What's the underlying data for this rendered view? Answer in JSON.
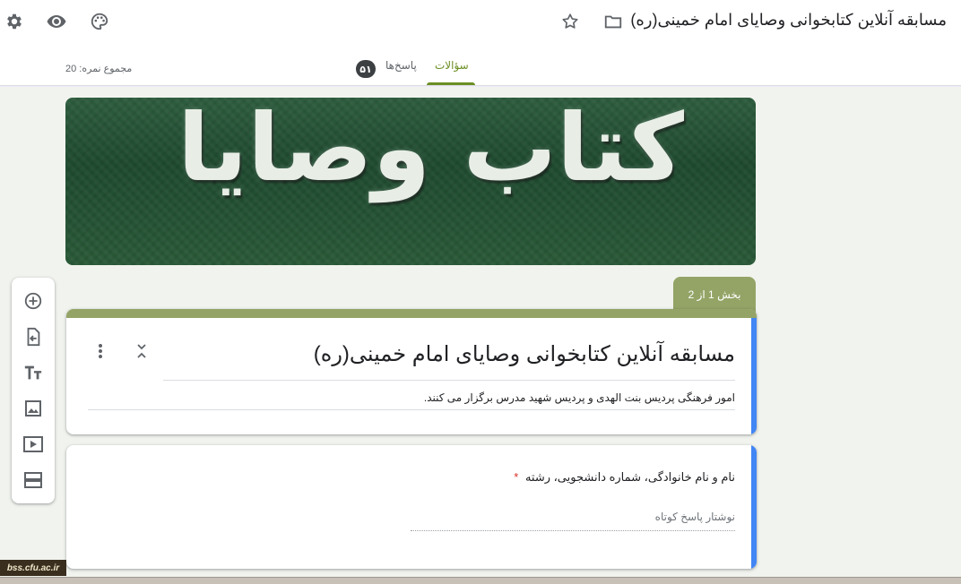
{
  "header": {
    "form_title": "مسابقه آنلاین کتابخوانی وصایای امام خمینی(ره)",
    "icons": [
      "settings-icon",
      "preview-eye-icon",
      "palette-icon",
      "star-icon",
      "folder-icon"
    ]
  },
  "tabs": {
    "questions_label": "سؤالات",
    "responses_label": "پاسخ‌ها",
    "responses_count": "۵۱",
    "total_points": "مجموع نمره: 20"
  },
  "header_image": {
    "big_text": "کتاب وصایا"
  },
  "section": {
    "indicator": "بخش 1 از 2"
  },
  "title_card": {
    "title": "مسابقه آنلاین کتابخوانی وصایای امام خمینی(ره)",
    "description": "امور فرهنگی پردیس بنت الهدی و پردیس شهید مدرس برگزار می کنند."
  },
  "question": {
    "text": "نام و نام خانوادگی، شماره دانشجویی، رشته",
    "required_mark": "*",
    "answer_placeholder": "نوشتار پاسخ کوتاه"
  },
  "toolbar": {
    "icons": [
      "add-question-icon",
      "import-questions-icon",
      "add-title-icon",
      "add-image-icon",
      "add-video-icon",
      "add-section-icon"
    ]
  },
  "watermark": "bss.cfu.ac.ir",
  "colors": {
    "accent": "#93a466",
    "active_tab": "#6b8e23",
    "focus_stripe": "#4285f4",
    "required": "#d93025"
  }
}
